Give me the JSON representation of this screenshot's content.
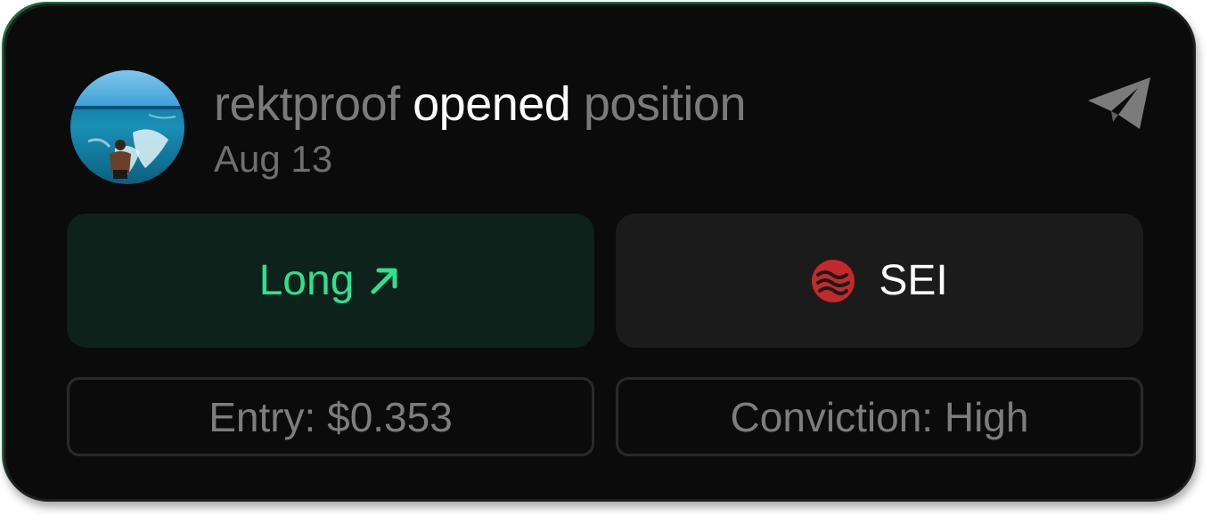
{
  "post": {
    "username": "rektproof",
    "action": "opened",
    "object": "position",
    "date": "Aug 13"
  },
  "position": {
    "direction_label": "Long",
    "direction_icon": "arrow-up-right-icon",
    "token_symbol": "SEI",
    "token_icon": "sei-logo-icon",
    "entry_text": "Entry: $0.353",
    "conviction_text": "Conviction: High"
  },
  "icons": {
    "share": "send-icon"
  },
  "colors": {
    "card_bg": "#0b0b0b",
    "long_bg": "#0d221a",
    "long_text": "#2ee08f",
    "token_bg": "#1b1b1b",
    "token_icon": "#c42a2a",
    "muted_text": "#7a7a7a",
    "accent_border": "#1f6b45"
  }
}
